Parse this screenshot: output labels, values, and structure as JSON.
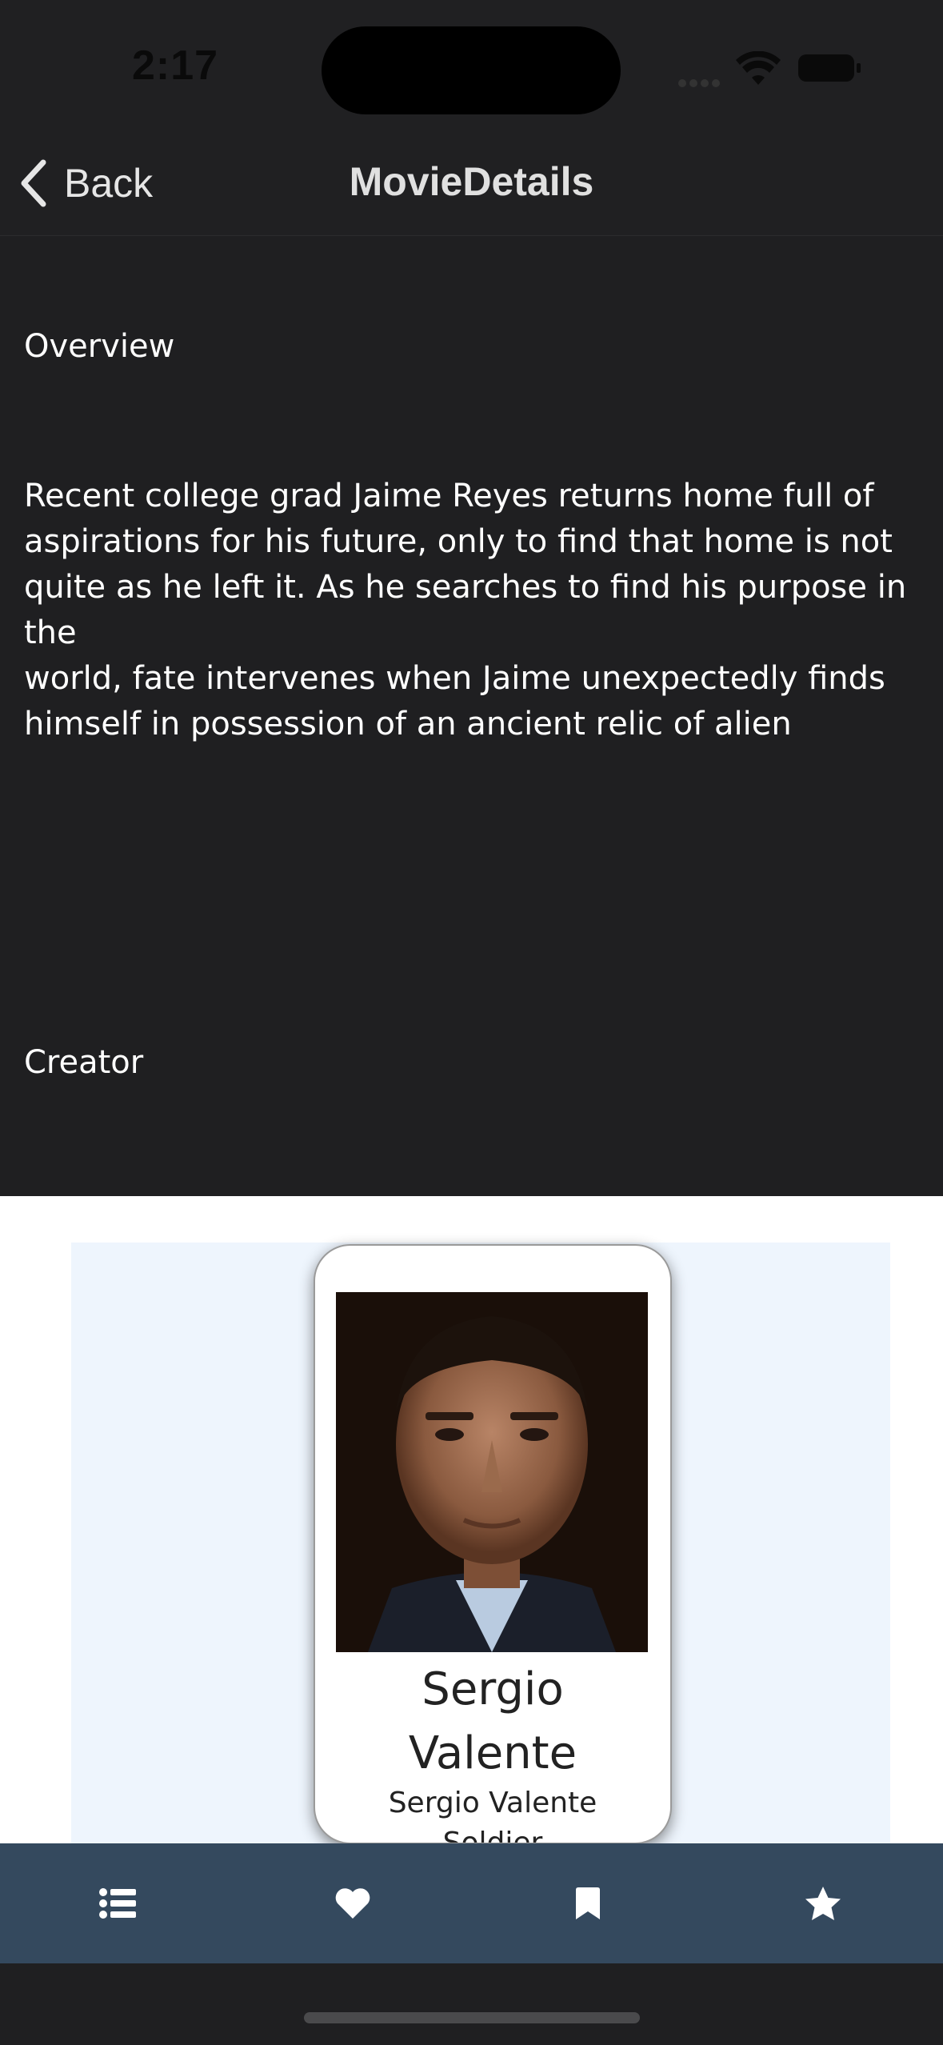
{
  "status_bar": {
    "time": "2:17"
  },
  "nav": {
    "back_label": "Back",
    "title": "MovieDetails"
  },
  "overview": {
    "label": "Overview",
    "lines": [
      "Recent college grad Jaime Reyes returns home full of",
      "aspirations for his future, only to find that home is not",
      "quite as he left it. As he searches to find his purpose in the",
      "world, fate intervenes when Jaime unexpectedly finds",
      "himself in possession of an ancient relic of alien"
    ]
  },
  "creator": {
    "label": "Creator",
    "card": {
      "name_line1": "Sergio",
      "name_line2": "Valente",
      "subtitle": "Sergio Valente",
      "role": "Soldier"
    }
  },
  "tab_bar": {
    "background": "#34495e",
    "items": [
      {
        "name": "list-icon"
      },
      {
        "name": "heart-icon"
      },
      {
        "name": "bookmark-icon"
      },
      {
        "name": "star-icon"
      }
    ]
  }
}
